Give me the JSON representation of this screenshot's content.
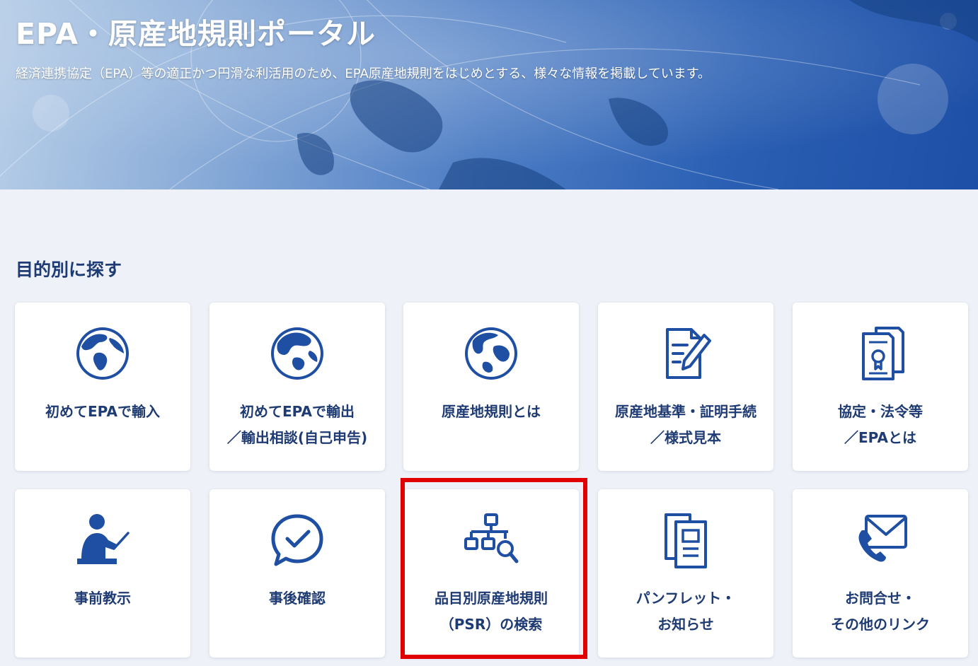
{
  "header": {
    "title": "EPA・原産地規則ポータル",
    "description": "経済連携協定（EPA）等の適正かつ円滑な利活用のため、EPA原産地規則をはじめとする、様々な情報を掲載しています。"
  },
  "section": {
    "title": "目的別に探す"
  },
  "cards": [
    {
      "icon": "globe-americas-icon",
      "lines": [
        "初めてEPAで輸入"
      ]
    },
    {
      "icon": "globe-asia-icon",
      "lines": [
        "初めてEPAで輸出",
        "／輸出相談(自己申告)"
      ]
    },
    {
      "icon": "globe-icon",
      "lines": [
        "原産地規則とは"
      ]
    },
    {
      "icon": "document-pen-icon",
      "lines": [
        "原産地基準・証明手続",
        "／様式見本"
      ]
    },
    {
      "icon": "certificate-documents-icon",
      "lines": [
        "協定・法令等",
        "／EPAとは"
      ]
    },
    {
      "icon": "presenter-icon",
      "lines": [
        "事前教示"
      ]
    },
    {
      "icon": "chat-check-icon",
      "lines": [
        "事後確認"
      ]
    },
    {
      "icon": "hierarchy-search-icon",
      "lines": [
        "品目別原産地規則",
        "（PSR）の検索"
      ]
    },
    {
      "icon": "pamphlet-icon",
      "lines": [
        "パンフレット・",
        "お知らせ"
      ]
    },
    {
      "icon": "phone-mail-icon",
      "lines": [
        "お問合せ・",
        "その他のリンク"
      ]
    }
  ],
  "colors": {
    "accent": "#1e4fa3",
    "heading": "#1f3b73",
    "highlight": "#e00000",
    "background": "#eef1f7"
  }
}
